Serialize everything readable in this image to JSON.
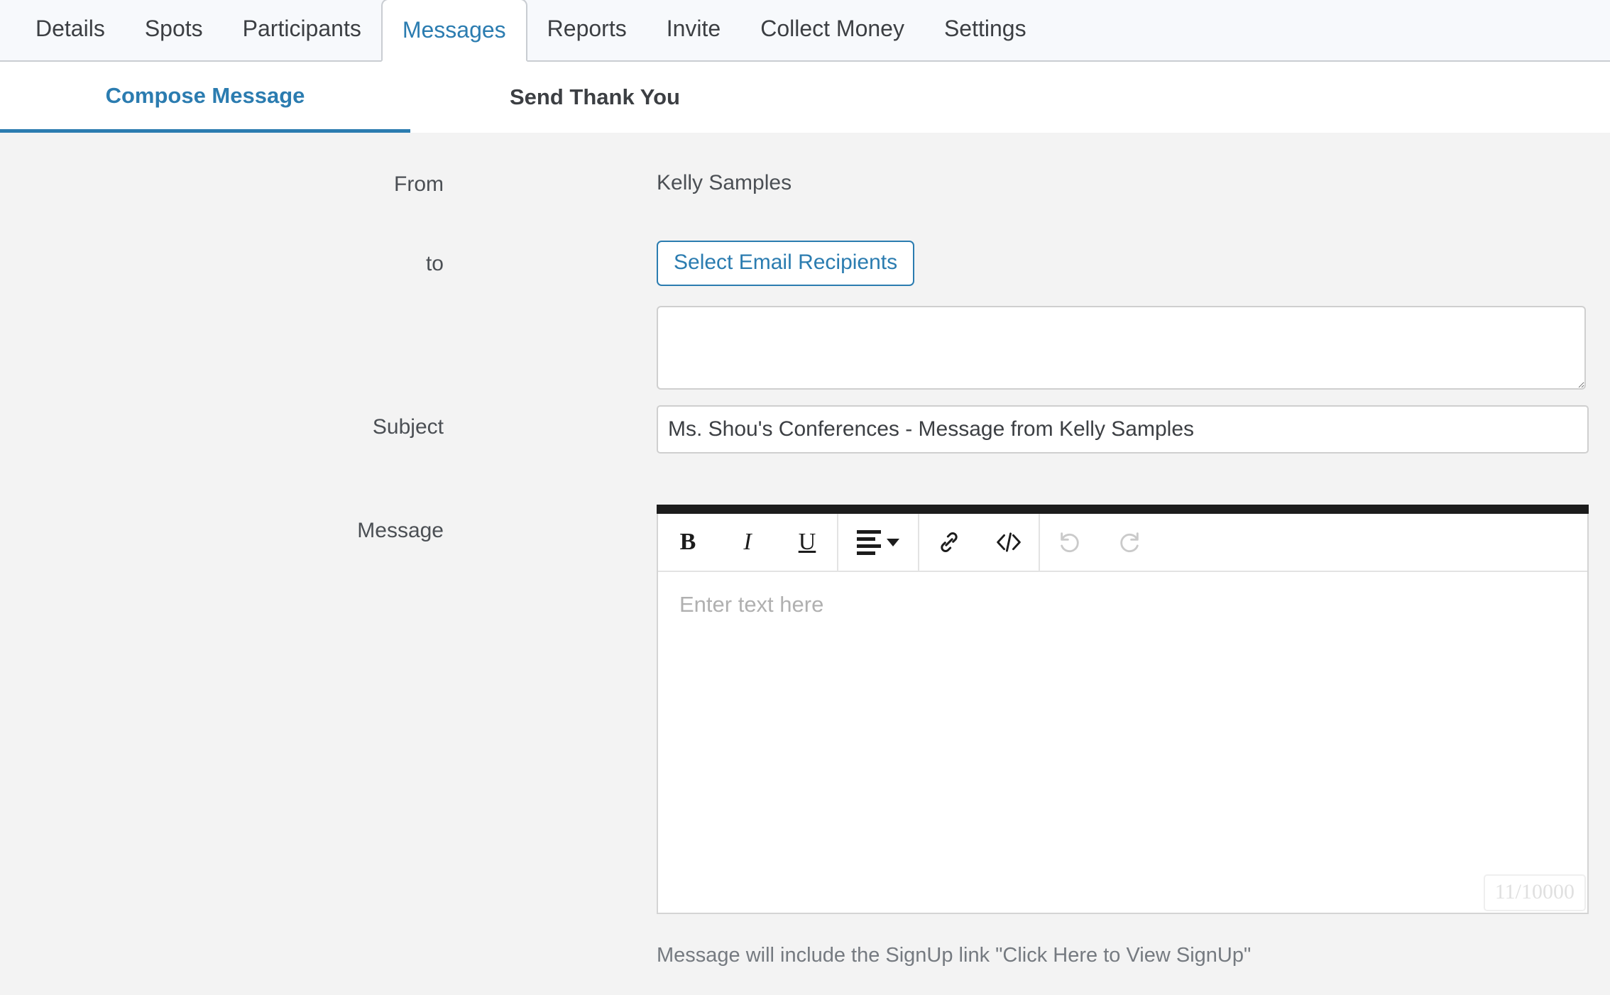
{
  "top_tabs": [
    {
      "label": "Details",
      "active": false
    },
    {
      "label": "Spots",
      "active": false
    },
    {
      "label": "Participants",
      "active": false
    },
    {
      "label": "Messages",
      "active": true
    },
    {
      "label": "Reports",
      "active": false
    },
    {
      "label": "Invite",
      "active": false
    },
    {
      "label": "Collect Money",
      "active": false
    },
    {
      "label": "Settings",
      "active": false
    }
  ],
  "sub_tabs": [
    {
      "label": "Compose Message",
      "active": true
    },
    {
      "label": "Send Thank You",
      "active": false
    }
  ],
  "form": {
    "from_label": "From",
    "from_value": "Kelly Samples",
    "to_label": "to",
    "select_recipients_label": "Select Email Recipients",
    "recipients_value": "",
    "recipients_placeholder": "",
    "subject_label": "Subject",
    "subject_value": "Ms. Shou's Conferences - Message from Kelly Samples",
    "subject_placeholder": "",
    "message_label": "Message",
    "message_placeholder": "Enter text here",
    "message_value": "",
    "char_counter": "11/10000",
    "footer_note": "Message will include the SignUp link \"Click Here to View SignUp\""
  },
  "toolbar": {
    "bold": "B",
    "italic": "I",
    "underline": "U",
    "align": "align-left",
    "link": "link",
    "code": "</>",
    "undo": "↺",
    "redo": "↻"
  },
  "colors": {
    "accent_blue": "#2b7cb0",
    "tabbar_bg": "#f7f9fc",
    "body_bg": "#f3f3f3",
    "text_dark": "#3c3f43",
    "editor_topbar": "#1c1c1c"
  }
}
